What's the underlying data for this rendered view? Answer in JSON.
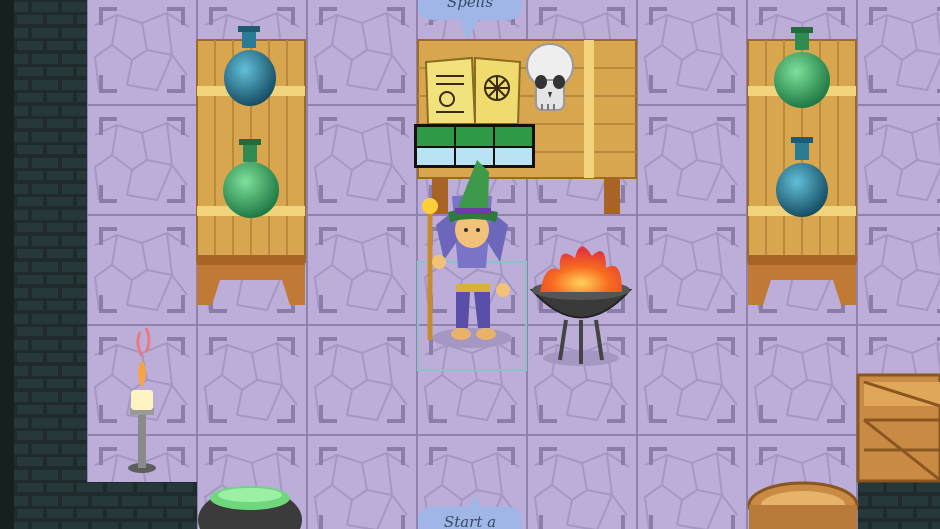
{
  "bubbles": {
    "top_text": "Spells",
    "bottom_text": "Start a"
  },
  "colors": {
    "floor_tile": "#bcaed8",
    "floor_crack": "#9d8fbc",
    "wall_dark": "#1e2a2b",
    "wood": "#d7a64f",
    "wood_dark": "#9c6a27",
    "potion_green": "#39a866",
    "potion_teal": "#2a7b96",
    "wizard_robe": "#7a74c8",
    "wizard_hat": "#3d9a4a",
    "fire": "#f05a23",
    "hud_green": "#2e9a45",
    "hud_blue": "#b9e3f2"
  },
  "hud": {
    "rows": 2,
    "cols": 3
  },
  "objects": [
    "potion-shelf-left",
    "spell-table",
    "spell-book",
    "skull",
    "wizard",
    "fire-brazier",
    "potion-shelf-right",
    "candle-stand",
    "cauldron",
    "wooden-crate",
    "wooden-tub"
  ]
}
